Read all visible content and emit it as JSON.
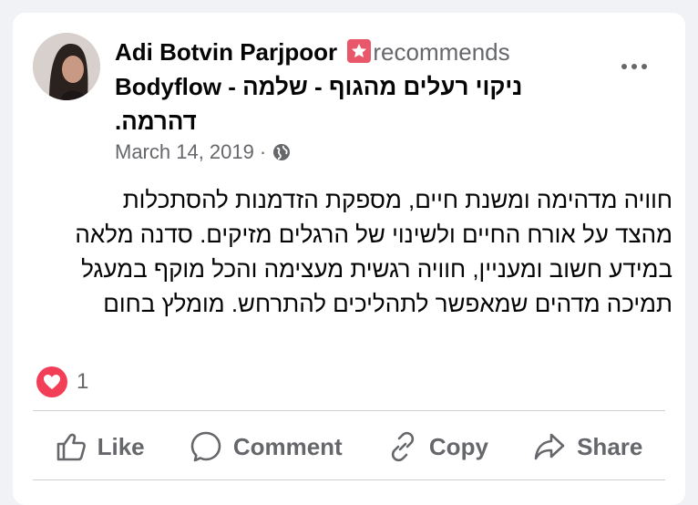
{
  "post": {
    "author": "Adi Botvin Parjpoor",
    "recommends_label": "recommends",
    "page_name_line1": "ניקוי רעלים מהגוף - שלמה - Bodyflow",
    "page_name_line2": "דהרמה.",
    "date": "March 14, 2019",
    "separator": "·",
    "audience_icon": "globe-icon",
    "body": "חוויה מדהימה ומשנת חיים, מספקת הזדמנות להסתכלות מהצד על אורח החיים ולשינוי של הרגלים מזיקים. סדנה מלאה במידע חשוב ומעניין, חוויה רגשית מעצימה והכל מוקף במעגל תמיכה מדהים שמאפשר לתהליכים להתרחש. מומלץ בחום"
  },
  "reactions": {
    "icon": "heart-icon",
    "count": "1"
  },
  "actions": {
    "like": "Like",
    "comment": "Comment",
    "copy": "Copy",
    "share": "Share"
  },
  "colors": {
    "badge": "#e8576a",
    "heart": "#f33e58",
    "muted": "#65676b"
  }
}
